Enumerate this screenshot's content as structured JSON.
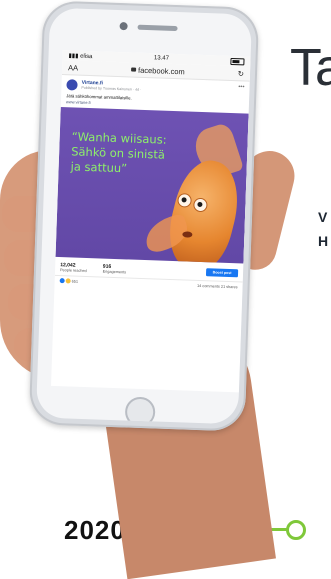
{
  "background": {
    "title_fragment": "Ta",
    "side_lines": [
      "V",
      "H"
    ],
    "year": "2020"
  },
  "status_bar": {
    "carrier": "elisa",
    "time": "13.47"
  },
  "browser": {
    "text_size": "AA",
    "url": "facebook.com"
  },
  "post": {
    "page_name": "Virtane.fi",
    "published_by": "Published by Tuomas Kainonen · 4d ·",
    "text": "Jätä sähköhommat ammattilaisille.",
    "link": "www.virtane.fi",
    "quote_lines": [
      "“Wanha wiisaus:",
      "Sähkö on sinistä",
      "ja sattuu”"
    ]
  },
  "stats": {
    "reached_value": "12,042",
    "reached_label": "People reached",
    "engagements_value": "916",
    "engagements_label": "Engagements",
    "boost_label": "Boost post"
  },
  "reactions": {
    "count": "651",
    "comments_shares": "14 comments  21 shares"
  },
  "colors": {
    "post_bg": "#6a4fae",
    "quote_text": "#8ef06a",
    "boost_button": "#1877f2",
    "timeline": "#7fc83a"
  }
}
